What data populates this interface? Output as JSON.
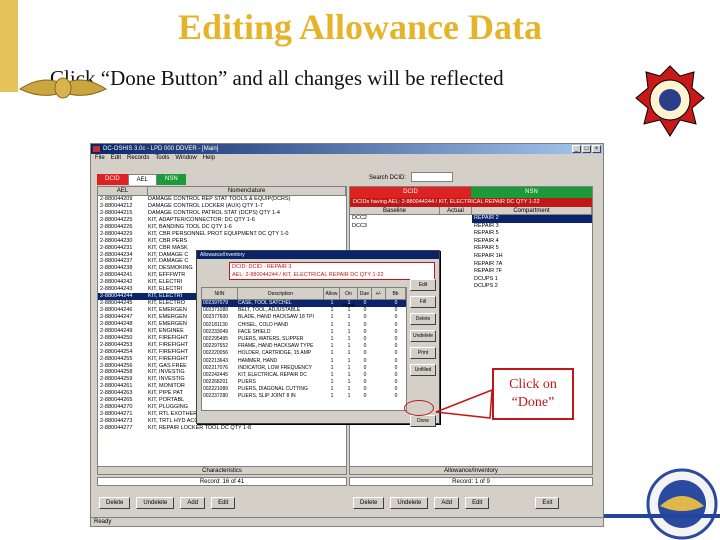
{
  "slide": {
    "title": "Editing Allowance Data",
    "subtitle": "Click “Done Button” and all changes will be reflected",
    "callout": "Click on “Done”"
  },
  "colors": {
    "title": "#e6b42a",
    "accent_red": "#c01818",
    "green": "#1b9a3a",
    "navy": "#0a246a"
  },
  "app": {
    "window_title": "DC-OSHIS 3.0c - LPD 000 DDVER - [Main]",
    "menu": [
      "File",
      "Edit",
      "Records",
      "Tools",
      "Window",
      "Help"
    ],
    "tabs": [
      "DCID",
      "AEL",
      "NSN"
    ],
    "search_label": "Search DCID:",
    "left_headers": [
      "AEL",
      "Nomenclature"
    ],
    "left_rows": [
      [
        "2-880044209",
        "DAMAGE CONTROL REP STAT TOOLS & EQUIP(DCRS)"
      ],
      [
        "2-880044212",
        "DAMAGE CONTROL LOCKER (AUX) QTY 1-7"
      ],
      [
        "2-880044215",
        "DAMAGE CONTROL PATROL STAT (DCPS) QTY 1-4"
      ],
      [
        "2-880044225",
        "KIT, ADAPTER/CONNECTOR: DC QTY 1-6"
      ],
      [
        "2-880044226",
        "KIT, BANDING TOOL DC QTY 1-6"
      ],
      [
        "2-880044229",
        "KIT, CBR PERSONNEL PROT EQUIPMENT DC QTY 1-0"
      ],
      [
        "2-880044230",
        "KIT, CBR PERS"
      ],
      [
        "2-880044231",
        "KIT, CBR MASK"
      ],
      [
        "2-880044234",
        "KIT, DAMAGE C"
      ],
      [
        "2-880044237",
        "KIT, DAMAGE C"
      ],
      [
        "2-880044238",
        "KIT, DESMOKING"
      ],
      [
        "2-880044241",
        "KIT, EFFFWTR"
      ],
      [
        "2-880044242",
        "KIT, ELECTRI"
      ],
      [
        "2-880044243",
        "KIT, ELECTRI"
      ],
      [
        "2-880044244",
        "KIT, ELECTRI"
      ],
      [
        "2-880044245",
        "KIT, ELECTRO"
      ],
      [
        "2-880044246",
        "KIT, EMERGEN"
      ],
      [
        "2-880044247",
        "KIT, EMERGEN"
      ],
      [
        "2-880044248",
        "KIT, EMERGEN"
      ],
      [
        "2-880044249",
        "KIT, ENGINEE"
      ],
      [
        "2-880044250",
        "KIT, FIREFIGHT"
      ],
      [
        "2-880044253",
        "KIT, FIREFIGHT"
      ],
      [
        "2-880044254",
        "KIT, FIREFIGHT"
      ],
      [
        "2-880044255",
        "KIT, FIREFIGHT"
      ],
      [
        "2-880044256",
        "KIT, GAS FREE"
      ],
      [
        "2-880044258",
        "KIT, INVESTIG"
      ],
      [
        "2-880044259",
        "KIT, INVESTIG"
      ],
      [
        "2-880044261",
        "KIT, MONITOR"
      ],
      [
        "2-880044263",
        "KIT, PIPE PAT"
      ],
      [
        "2-880044265",
        "KIT, PORTABL"
      ],
      [
        "2-880044270",
        "KIT, PLUGGING"
      ],
      [
        "2-880044271",
        "KIT, RTL EXOTHERM CUTTING UNIT REPAIR QTY1-8"
      ],
      [
        "2-880044273",
        "KIT, TRTL HYD ACCESS/RESCUE SYS (HARS) QTY1-2"
      ],
      [
        "2-880044277",
        "KIT, REPAIR LOCKER TOOL DC QTY 1-8"
      ]
    ],
    "left_selected": 14,
    "characteristics_label": "Characteristics",
    "left_record": "Record: 16 of 41",
    "right_tabs": [
      "DCID",
      "NSN"
    ],
    "right_sub": "DCIDs having AEL: 2-880044244 / KIT, ELECTRICAL REPAIR DC QTY 1-22",
    "right_headers": [
      "Baseline",
      "Actual",
      "Compartment"
    ],
    "right_rows": [
      [
        "DCC2",
        "",
        "REPAIR 2"
      ],
      [
        "DCC3",
        "",
        "REPAIR 3"
      ],
      [
        "",
        "",
        "REPAIR 5"
      ],
      [
        "",
        "",
        "REPAIR 4"
      ],
      [
        "",
        "",
        "REPAIR 5"
      ],
      [
        "",
        "",
        "REPAIR 1H"
      ],
      [
        "",
        "",
        "REPAIR 7A"
      ],
      [
        "",
        "",
        "REPAIR 7F"
      ],
      [
        "",
        "",
        "DCUPS 1"
      ],
      [
        "",
        "",
        "DCUPS 2"
      ]
    ],
    "allowance_label": "Allowance/Inventory",
    "right_record": "Record: 1 of 9",
    "left_buttons": [
      "Delete",
      "Undelete",
      "Add",
      "Edit"
    ],
    "right_buttons": [
      "Delete",
      "Undelete",
      "Add",
      "Edit",
      "Exit"
    ],
    "status": "Ready"
  },
  "dialog": {
    "title": "Allowance/Inventory",
    "dcid_line": "DCID: DCID - REPAIR 3",
    "ael_line": "AEL: 2-880044244 / KIT, ELECTRICAL REPAIR DC QTY 1-22",
    "headers": [
      "NIIN",
      "Description",
      "Allow",
      "On Hand",
      "Due",
      "+/-",
      "Bb"
    ],
    "rows": [
      [
        "002397079",
        "CASE, TOOL SATCHEL",
        "1",
        "1",
        "0",
        "",
        "0"
      ],
      [
        "002371088",
        "BELT, TOOL, ADJUSTABLE",
        "1",
        "1",
        "0",
        "",
        "0"
      ],
      [
        "002377600",
        "BLADE, HAND HACKSAW 18 TPI",
        "1",
        "1",
        "0",
        "",
        "0"
      ],
      [
        "002181130",
        "CHISEL, COLD HAND",
        "1",
        "1",
        "0",
        "",
        "0"
      ],
      [
        "002233049",
        "FACE SHIELD",
        "1",
        "1",
        "0",
        "",
        "0"
      ],
      [
        "002295495",
        "PLIERS, WATERS, SLIPPER",
        "1",
        "1",
        "0",
        "",
        "0"
      ],
      [
        "002297652",
        "FRAME, HAND HACKSAW TYPE",
        "1",
        "1",
        "0",
        "",
        "0"
      ],
      [
        "002220056",
        "HOLDER, CARTRIDGE, 15 AMP",
        "1",
        "1",
        "0",
        "",
        "0"
      ],
      [
        "002213643",
        "HAMMER, HAND",
        "1",
        "1",
        "0",
        "",
        "0"
      ],
      [
        "002217076",
        "INDICATOR, LOW FREQUENCY",
        "1",
        "1",
        "0",
        "",
        "0"
      ],
      [
        "002242445",
        "KIT, ELECTRICAL REPAIR DC",
        "1",
        "1",
        "0",
        "",
        "0"
      ],
      [
        "002268201",
        "PLIERS",
        "1",
        "1",
        "0",
        "",
        "0"
      ],
      [
        "002221089",
        "PLIERS, DIAGONAL CUTTING",
        "1",
        "1",
        "0",
        "",
        "0"
      ],
      [
        "002237280",
        "PLIERS, SLIP JOINT 8 IN",
        "1",
        "1",
        "0",
        "",
        "0"
      ]
    ],
    "selected": 0,
    "buttons": [
      "Edit",
      "Fill",
      "Delete",
      "Undelete",
      "Print",
      "Unfilled",
      "Done"
    ]
  }
}
